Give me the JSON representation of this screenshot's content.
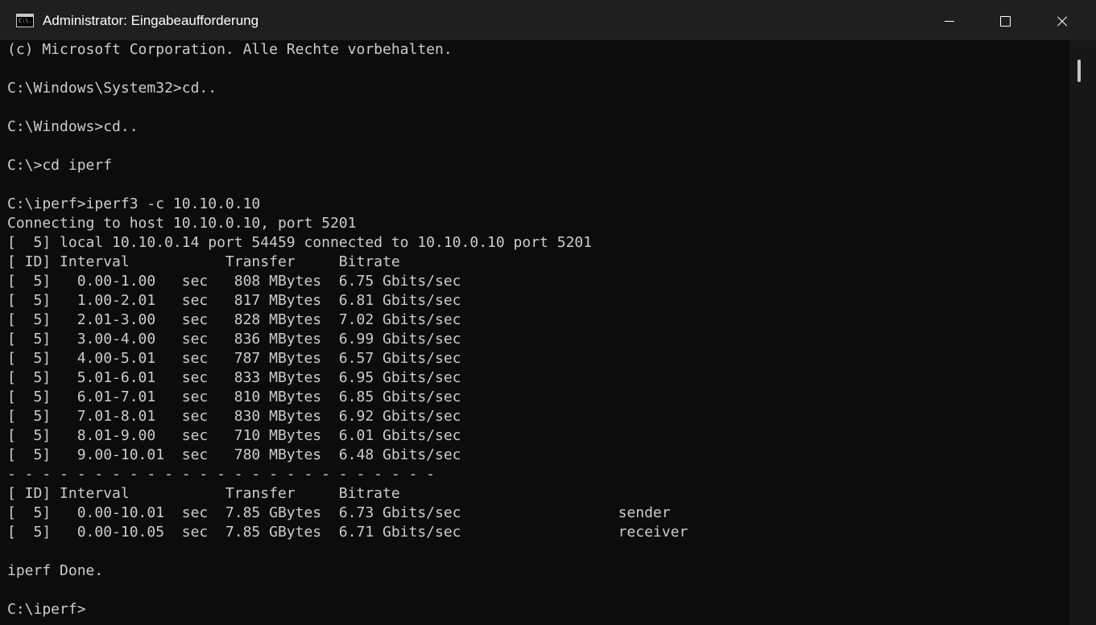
{
  "window": {
    "title": "Administrator: Eingabeaufforderung",
    "icon_text": "C:\\."
  },
  "colors": {
    "titlebar": "#1f1f1f",
    "console_bg": "#0c0c0c",
    "console_text": "#cccccc"
  },
  "console": {
    "lines": [
      "(c) Microsoft Corporation. Alle Rechte vorbehalten.",
      "",
      "C:\\Windows\\System32>cd..",
      "",
      "C:\\Windows>cd..",
      "",
      "C:\\>cd iperf",
      "",
      "C:\\iperf>iperf3 -c 10.10.0.10",
      "Connecting to host 10.10.0.10, port 5201",
      "[  5] local 10.10.0.14 port 54459 connected to 10.10.0.10 port 5201",
      "[ ID] Interval           Transfer     Bitrate",
      "[  5]   0.00-1.00   sec   808 MBytes  6.75 Gbits/sec",
      "[  5]   1.00-2.01   sec   817 MBytes  6.81 Gbits/sec",
      "[  5]   2.01-3.00   sec   828 MBytes  7.02 Gbits/sec",
      "[  5]   3.00-4.00   sec   836 MBytes  6.99 Gbits/sec",
      "[  5]   4.00-5.01   sec   787 MBytes  6.57 Gbits/sec",
      "[  5]   5.01-6.01   sec   833 MBytes  6.95 Gbits/sec",
      "[  5]   6.01-7.01   sec   810 MBytes  6.85 Gbits/sec",
      "[  5]   7.01-8.01   sec   830 MBytes  6.92 Gbits/sec",
      "[  5]   8.01-9.00   sec   710 MBytes  6.01 Gbits/sec",
      "[  5]   9.00-10.01  sec   780 MBytes  6.48 Gbits/sec",
      "- - - - - - - - - - - - - - - - - - - - - - - - -",
      "[ ID] Interval           Transfer     Bitrate",
      "[  5]   0.00-10.01  sec  7.85 GBytes  6.73 Gbits/sec                  sender",
      "[  5]   0.00-10.05  sec  7.85 GBytes  6.71 Gbits/sec                  receiver",
      "",
      "iperf Done.",
      "",
      "C:\\iperf>"
    ]
  }
}
